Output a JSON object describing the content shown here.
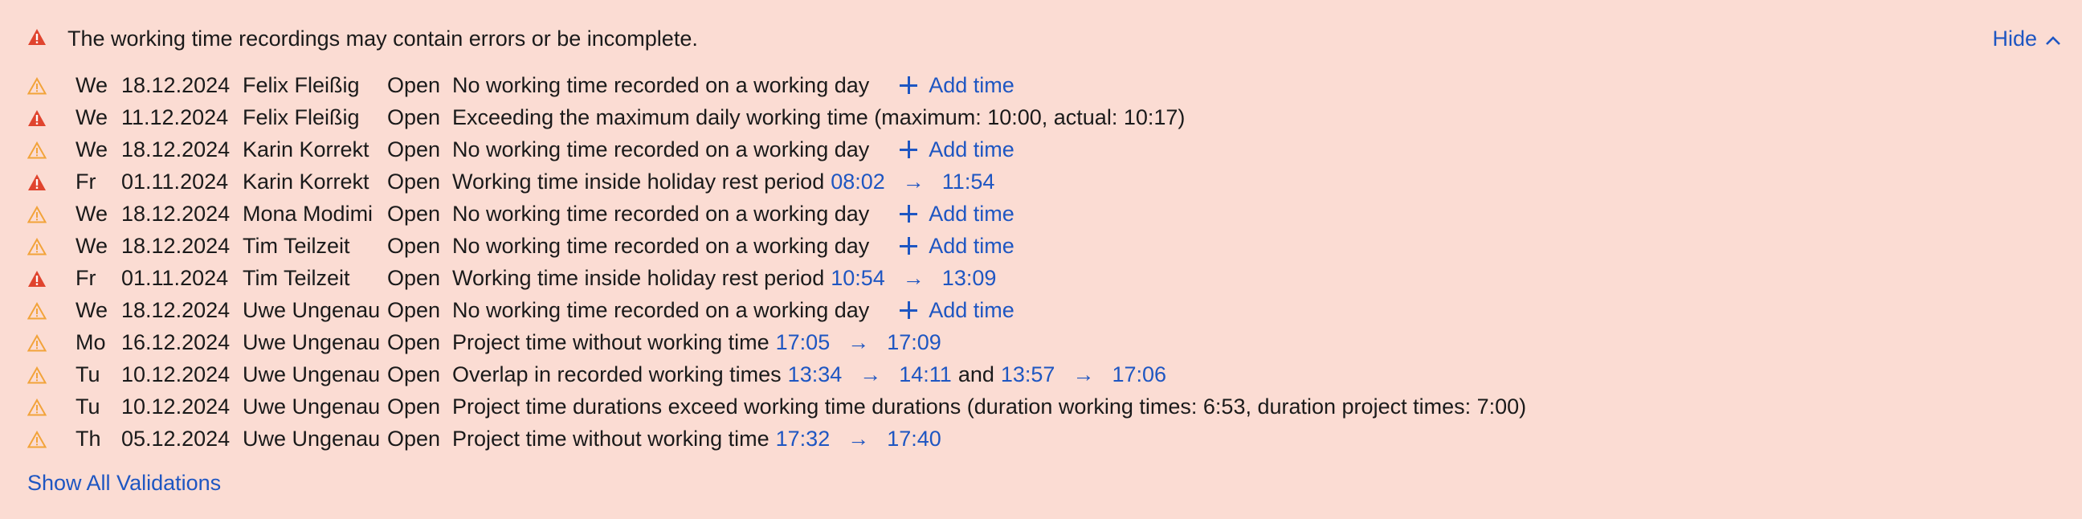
{
  "banner": {
    "message": "The working time recordings may contain errors or be incomplete.",
    "hide_label": "Hide",
    "show_all_label": "Show All Validations",
    "colors": {
      "background": "#fbdcd3",
      "error": "#e0442e",
      "warning": "#f2a33a",
      "link": "#1e56c2"
    }
  },
  "rows": [
    {
      "severity": "warning",
      "day": "We",
      "date": "18.12.2024",
      "name": "Felix Fleißig",
      "status": "Open",
      "text": "No working time recorded on a working day",
      "action": "+ Add time",
      "action_label": "Add time"
    },
    {
      "severity": "error",
      "day": "We",
      "date": "11.12.2024",
      "name": "Felix Fleißig",
      "status": "Open",
      "text": "Exceeding the maximum daily working time (maximum: 10:00, actual: 10:17)"
    },
    {
      "severity": "warning",
      "day": "We",
      "date": "18.12.2024",
      "name": "Karin Korrekt",
      "status": "Open",
      "text": "No working time recorded on a working day",
      "action_label": "Add time"
    },
    {
      "severity": "error",
      "day": "Fr",
      "date": "01.11.2024",
      "name": "Karin Korrekt",
      "status": "Open",
      "text": "Working time inside holiday rest period",
      "ranges": [
        {
          "from": "08:02",
          "to": "11:54"
        }
      ]
    },
    {
      "severity": "warning",
      "day": "We",
      "date": "18.12.2024",
      "name": "Mona Modimi",
      "status": "Open",
      "text": "No working time recorded on a working day",
      "action_label": "Add time"
    },
    {
      "severity": "warning",
      "day": "We",
      "date": "18.12.2024",
      "name": "Tim Teilzeit",
      "status": "Open",
      "text": "No working time recorded on a working day",
      "action_label": "Add time"
    },
    {
      "severity": "error",
      "day": "Fr",
      "date": "01.11.2024",
      "name": "Tim Teilzeit",
      "status": "Open",
      "text": "Working time inside holiday rest period",
      "ranges": [
        {
          "from": "10:54",
          "to": "13:09"
        }
      ]
    },
    {
      "severity": "warning",
      "day": "We",
      "date": "18.12.2024",
      "name": "Uwe Ungenau",
      "status": "Open",
      "text": "No working time recorded on a working day",
      "action_label": "Add time"
    },
    {
      "severity": "warning",
      "day": "Mo",
      "date": "16.12.2024",
      "name": "Uwe Ungenau",
      "status": "Open",
      "text": "Project time without working time",
      "ranges": [
        {
          "from": "17:05",
          "to": "17:09"
        }
      ]
    },
    {
      "severity": "warning",
      "day": "Tu",
      "date": "10.12.2024",
      "name": "Uwe Ungenau",
      "status": "Open",
      "text": "Overlap in recorded working times",
      "ranges": [
        {
          "from": "13:34",
          "to": "14:11"
        },
        {
          "from": "13:57",
          "to": "17:06"
        }
      ],
      "joiner": "and"
    },
    {
      "severity": "warning",
      "day": "Tu",
      "date": "10.12.2024",
      "name": "Uwe Ungenau",
      "status": "Open",
      "text": "Project time durations exceed working time durations (duration working times: 6:53, duration project times: 7:00)"
    },
    {
      "severity": "warning",
      "day": "Th",
      "date": "05.12.2024",
      "name": "Uwe Ungenau",
      "status": "Open",
      "text": "Project time without working time",
      "ranges": [
        {
          "from": "17:32",
          "to": "17:40"
        }
      ]
    }
  ],
  "arrow_glyph": "→"
}
